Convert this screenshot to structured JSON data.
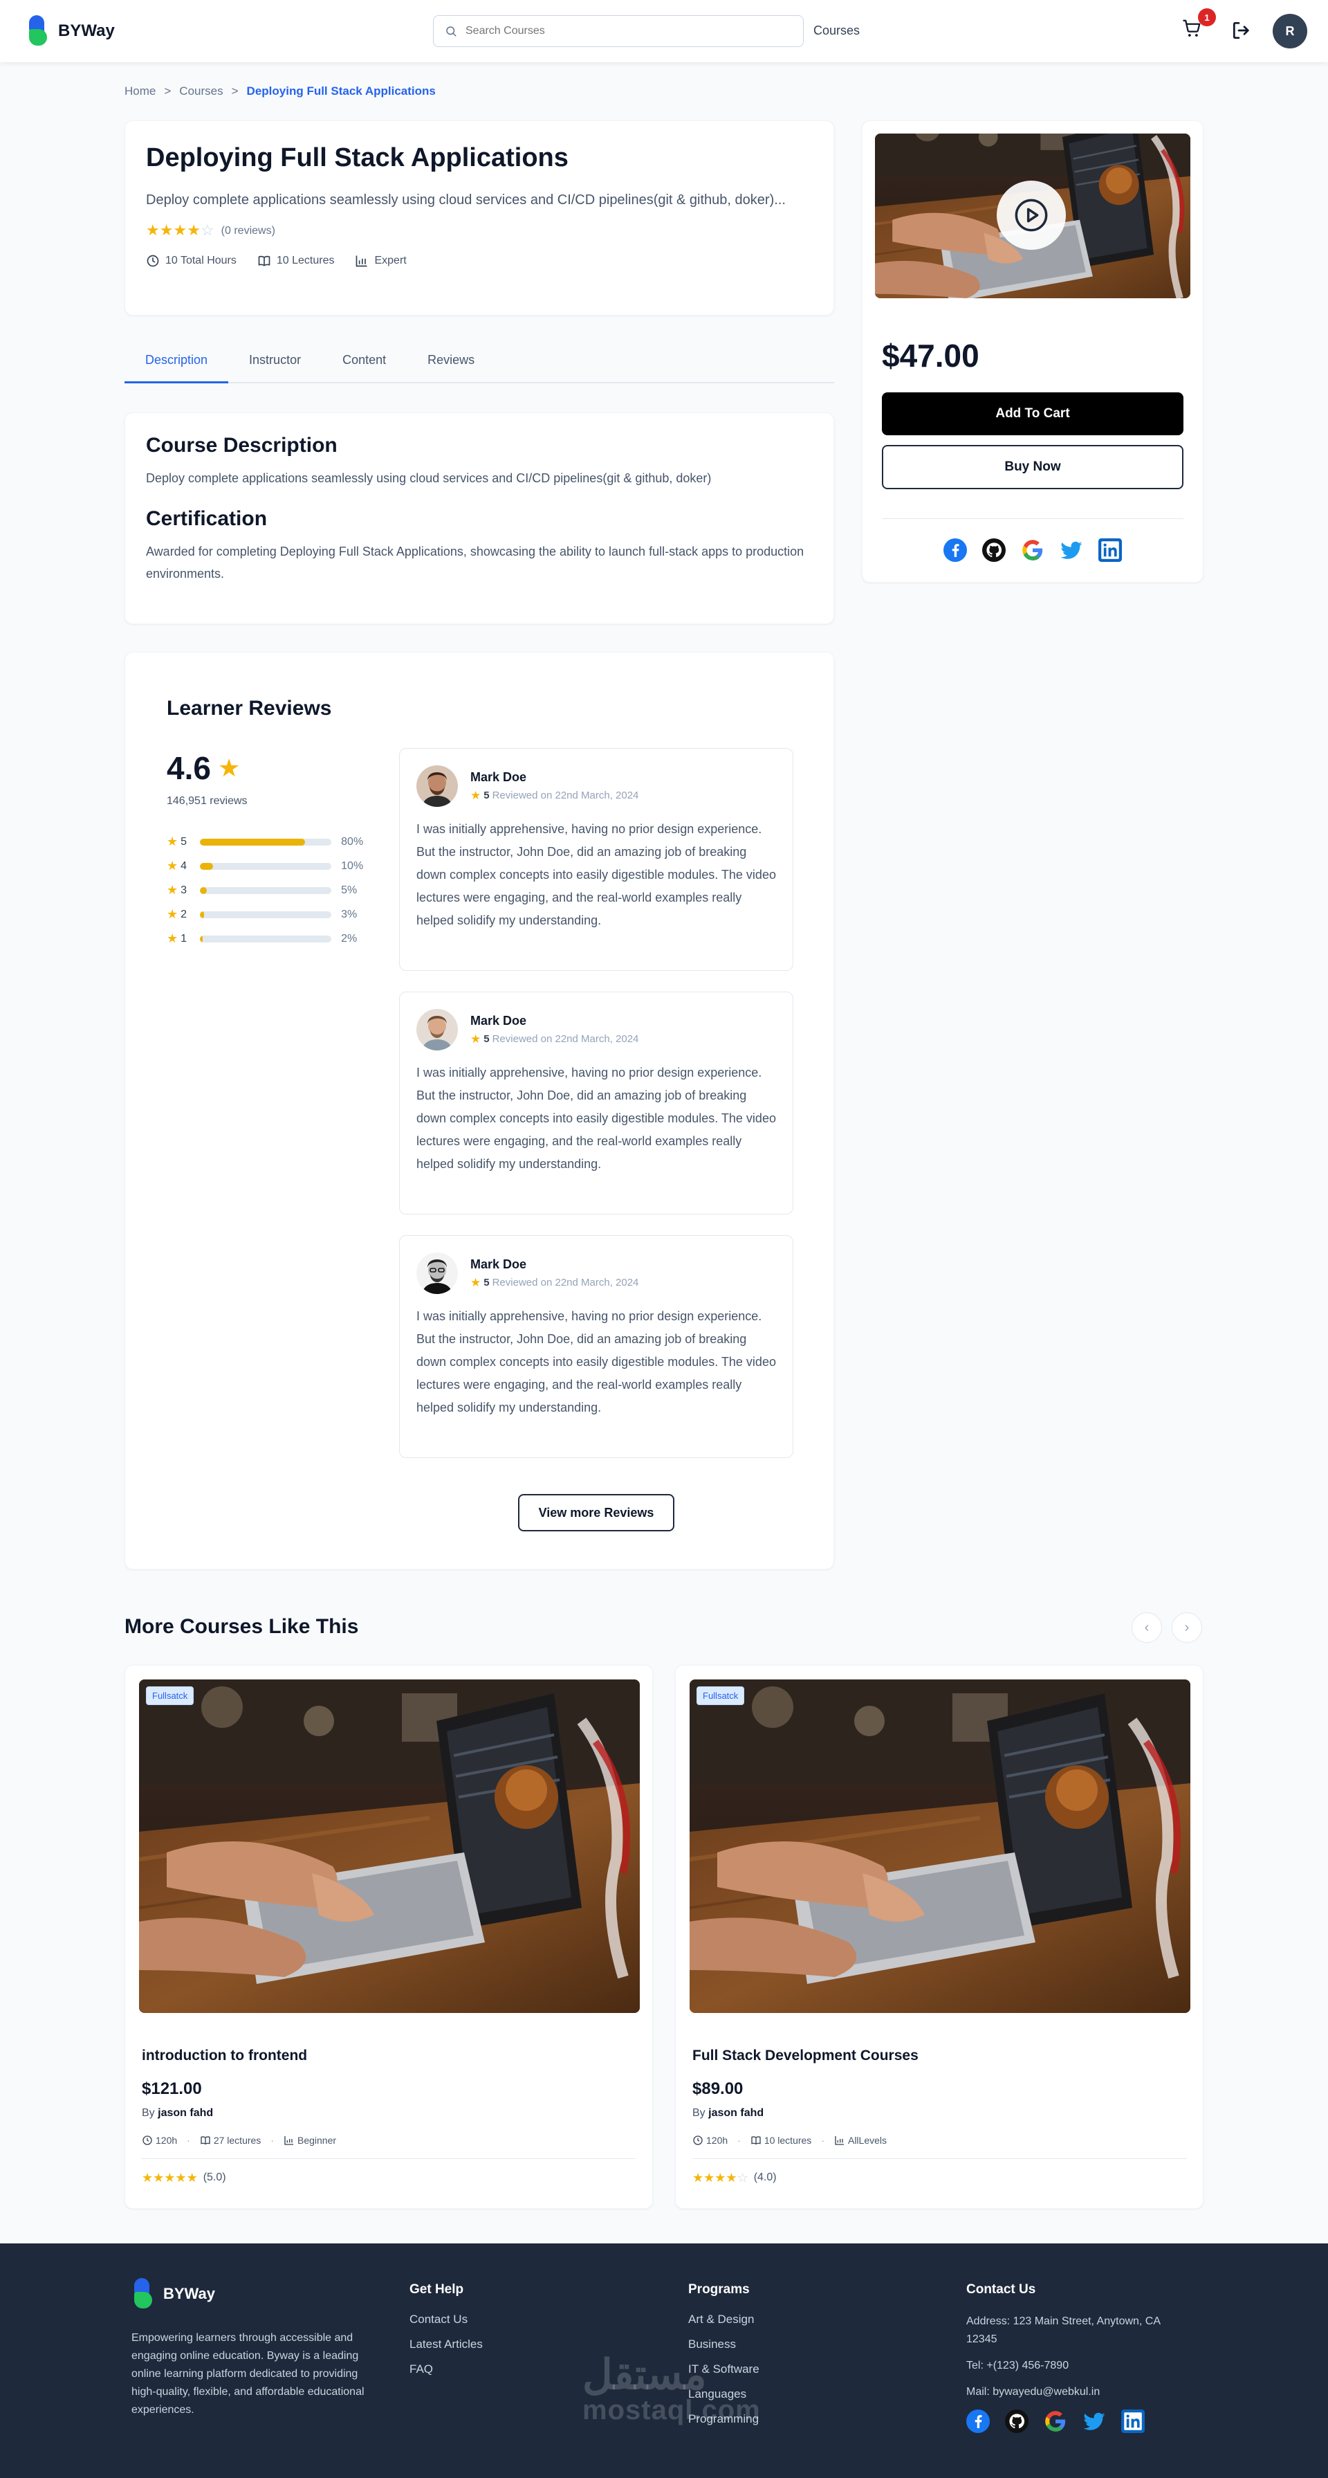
{
  "navbar": {
    "brand": "BYWay",
    "search_placeholder": "Search Courses",
    "courses_link": "Courses",
    "cart_count": "1",
    "user_initial": "R"
  },
  "breadcrumb": {
    "home": "Home",
    "sep1": ">",
    "courses": "Courses",
    "sep2": ">",
    "current": "Deploying Full Stack Applications"
  },
  "course": {
    "title": "Deploying Full Stack Applications",
    "subtitle": "Deploy complete applications seamlessly using cloud services and CI/CD pipelines(git & github, doker)...",
    "rating_stars": 4,
    "reviews_label": "(0 reviews)",
    "hours": "10 Total Hours",
    "lectures": "10 Lectures",
    "level": "Expert"
  },
  "tabs": [
    "Description",
    "Instructor",
    "Content",
    "Reviews"
  ],
  "description": {
    "heading": "Course Description",
    "text": "Deploy complete applications seamlessly using cloud services and CI/CD pipelines(git & github, doker)",
    "cert_heading": "Certification",
    "cert_text": "Awarded for completing Deploying Full Stack Applications, showcasing the ability to launch full-stack apps to production environments."
  },
  "purchase": {
    "price": "$47.00",
    "add_to_cart": "Add To Cart",
    "buy_now": "Buy Now",
    "share_icons": [
      "facebook-icon",
      "github-icon",
      "google-icon",
      "twitter-icon",
      "linkedin-icon"
    ]
  },
  "reviews": {
    "title": "Learner Reviews",
    "average": "4.6",
    "count": "146,951 reviews",
    "distribution": [
      {
        "stars": "5",
        "percent": 80,
        "label": "80%"
      },
      {
        "stars": "4",
        "percent": 10,
        "label": "10%"
      },
      {
        "stars": "3",
        "percent": 5,
        "label": "5%"
      },
      {
        "stars": "2",
        "percent": 3,
        "label": "3%"
      },
      {
        "stars": "1",
        "percent": 2,
        "label": "2%"
      }
    ],
    "items": [
      {
        "name": "Mark Doe",
        "rating": "5",
        "date": "Reviewed on 22nd March, 2024",
        "text": "I was initially apprehensive, having no prior design experience. But the instructor, John Doe, did an amazing job of breaking down complex concepts into easily digestible modules. The video lectures were engaging, and the real-world examples really helped solidify my understanding."
      },
      {
        "name": "Mark Doe",
        "rating": "5",
        "date": "Reviewed on 22nd March, 2024",
        "text": "I was initially apprehensive, having no prior design experience. But the instructor, John Doe, did an amazing job of breaking down complex concepts into easily digestible modules. The video lectures were engaging, and the real-world examples really helped solidify my understanding."
      },
      {
        "name": "Mark Doe",
        "rating": "5",
        "date": "Reviewed on 22nd March, 2024",
        "text": "I was initially apprehensive, having no prior design experience. But the instructor, John Doe, did an amazing job of breaking down complex concepts into easily digestible modules. The video lectures were engaging, and the real-world examples really helped solidify my understanding."
      }
    ],
    "view_more": "View more Reviews"
  },
  "more_courses": {
    "title": "More Courses Like This",
    "prev": "‹",
    "next": "›",
    "items": [
      {
        "tag": "Fullsatck",
        "title": "introduction to frontend",
        "price": "$121.00",
        "by": "By",
        "author": "jason fahd",
        "hours": "120h",
        "lectures": "27 lectures",
        "level": "Beginner",
        "stars": 5,
        "rating": "(5.0)"
      },
      {
        "tag": "Fullsatck",
        "title": "Full Stack Development Courses",
        "price": "$89.00",
        "by": "By",
        "author": "jason fahd",
        "hours": "120h",
        "lectures": "10 lectures",
        "level": "AllLevels",
        "stars": 4,
        "rating": "(4.0)"
      }
    ]
  },
  "footer": {
    "brand": "BYWay",
    "description": "Empowering learners through accessible and engaging online education. Byway is a leading online learning platform dedicated to providing high-quality, flexible, and affordable educational experiences.",
    "get_help": {
      "title": "Get Help",
      "links": [
        "Contact Us",
        "Latest Articles",
        "FAQ"
      ]
    },
    "programs": {
      "title": "Programs",
      "links": [
        "Art & Design",
        "Business",
        "IT & Software",
        "Languages",
        "Programming"
      ]
    },
    "contact": {
      "title": "Contact Us",
      "address": "Address: 123 Main Street, Anytown, CA 12345",
      "tel": "Tel: +(123) 456-7890",
      "mail": "Mail: bywayedu@webkul.in"
    },
    "watermark_ar": "مستقل",
    "watermark_lat": "mostaql.com"
  },
  "colors": {
    "accent": "#2563eb",
    "star": "#f5b50a",
    "footer_bg": "#1e293b"
  }
}
